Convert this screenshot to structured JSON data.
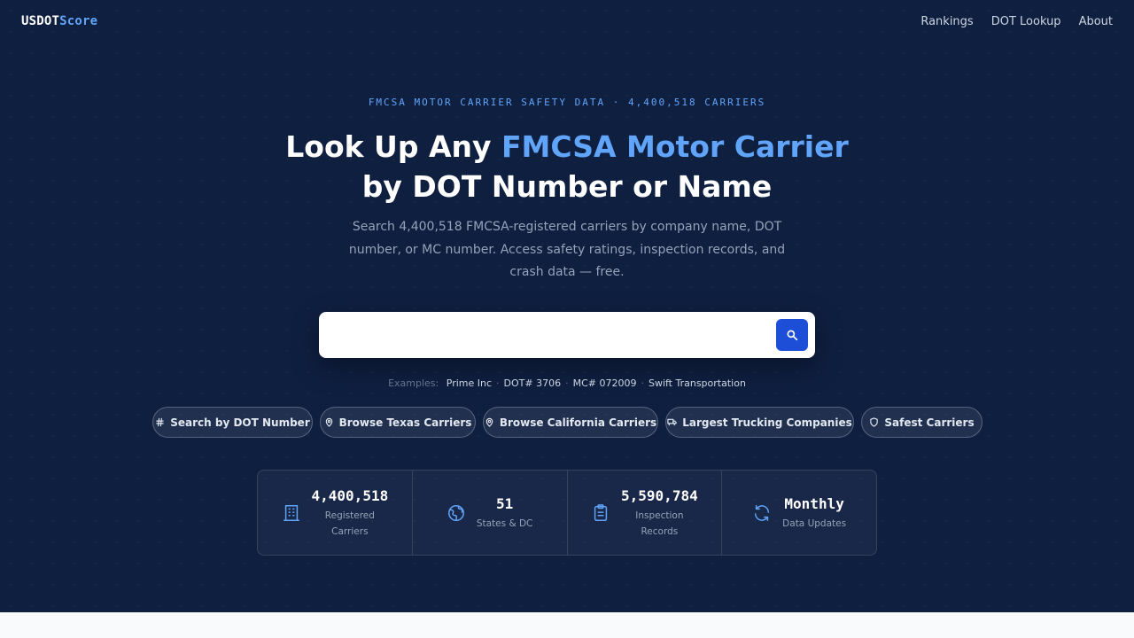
{
  "nav": {
    "logo_main": "USDOT",
    "logo_accent": "Score",
    "links": [
      "Rankings",
      "DOT Lookup",
      "About"
    ]
  },
  "hero": {
    "eyebrow": "FMCSA MOTOR CARRIER SAFETY DATA · 4,400,518 CARRIERS",
    "headline_part1": "Look Up Any ",
    "headline_highlight": "FMCSA Motor Carrier",
    "headline_part2": "by DOT Number or Name",
    "subtext": "Search 4,400,518 FMCSA-registered carriers by company name, DOT number, or MC number. Access safety ratings, inspection records, and crash data — free."
  },
  "search": {
    "value": "",
    "placeholder": "",
    "button_icon": "search-icon"
  },
  "examples": {
    "label": "Examples:",
    "items": [
      "Prime Inc",
      "DOT# 3706",
      "MC# 072009",
      "Swift Transportation"
    ]
  },
  "pills": [
    {
      "label": "Search by DOT Number",
      "icon": "hash-icon"
    },
    {
      "label": "Browse Texas Carriers",
      "icon": "map-pin-icon"
    },
    {
      "label": "Browse California Carriers",
      "icon": "map-pin-icon"
    },
    {
      "label": "Largest Trucking Companies",
      "icon": "truck-icon"
    },
    {
      "label": "Safest Carriers",
      "icon": "shield-icon"
    }
  ],
  "stats": [
    {
      "value": "4,400,518",
      "label": "Registered Carriers",
      "icon": "building-icon"
    },
    {
      "value": "51",
      "label": "States & DC",
      "icon": "globe-icon"
    },
    {
      "value": "5,590,784",
      "label": "Inspection Records",
      "icon": "clipboard-icon"
    },
    {
      "value": "Monthly",
      "label": "Data Updates",
      "icon": "refresh-icon"
    }
  ],
  "colors": {
    "background": "#0f1f40",
    "accent": "#60a5fa",
    "button": "#1d4ed8"
  }
}
